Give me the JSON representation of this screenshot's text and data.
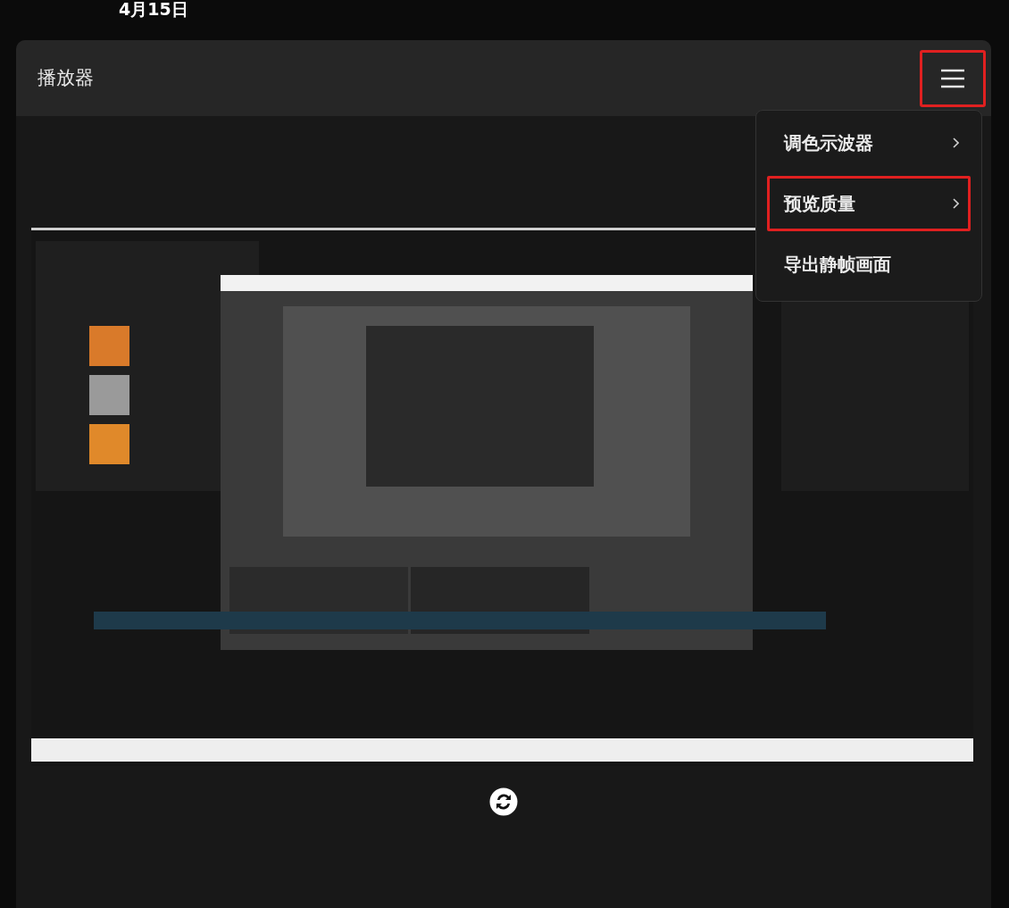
{
  "date": "4月15日",
  "panel": {
    "title": "播放器",
    "menu_button": {
      "highlighted": true
    }
  },
  "menu": [
    {
      "label": "调色示波器",
      "has_submenu": true,
      "highlighted": false
    },
    {
      "label": "预览质量",
      "has_submenu": true,
      "highlighted": true
    },
    {
      "label": "导出静帧画面",
      "has_submenu": false,
      "highlighted": false
    }
  ]
}
